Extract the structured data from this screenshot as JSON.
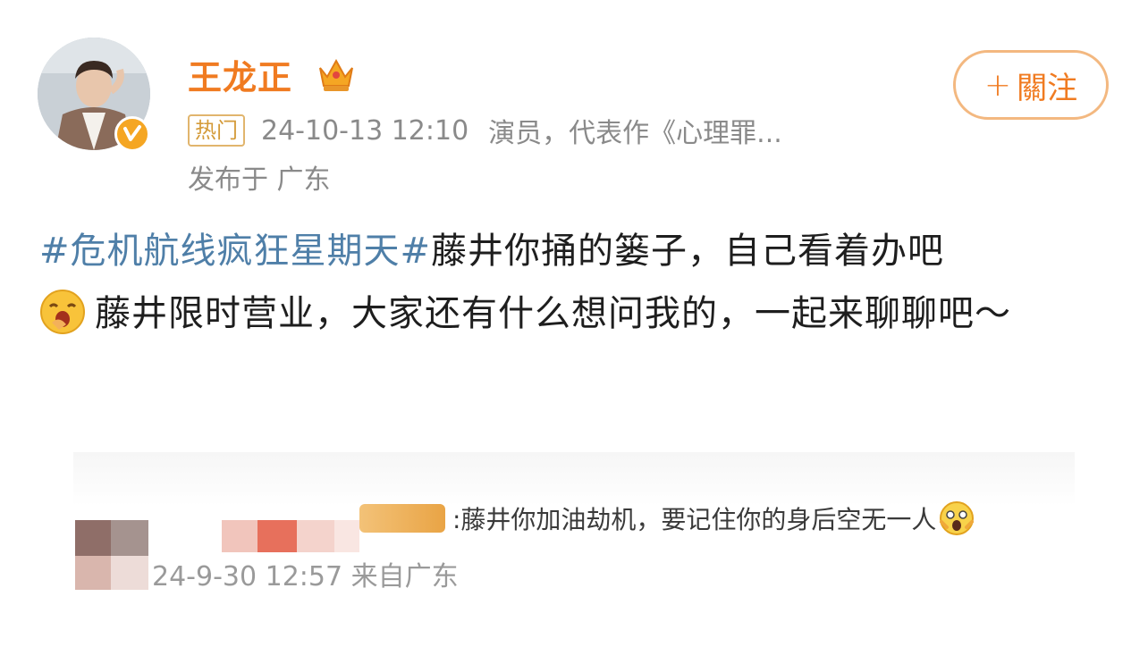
{
  "user": {
    "name": "王龙正",
    "badge": "热门",
    "time": "24-10-13 12:10",
    "description": "演员，代表作《心理罪...",
    "location": "发布于 广东"
  },
  "follow_button": {
    "plus": "+",
    "label": "關注"
  },
  "post": {
    "hashtag": "#危机航线疯狂星期天#",
    "line1_rest": "藤井你捅的篓子，自己看着办吧",
    "line2": "藤井限时营业，大家还有什么想问我的，一起来聊聊吧～"
  },
  "comment": {
    "text": ":藤井你加油劫机，要记住你的身后空无一人",
    "time": "24-9-30 12:57 来自广东"
  },
  "colors": {
    "name": "#f07b21",
    "hashtag": "#4f7fa8",
    "meta": "#8a8a8a",
    "follow_border": "#f3b880"
  },
  "icons": {
    "crown": "crown-icon",
    "verified": "verified-icon",
    "emoji_yawn": "yawn-emoji-icon",
    "emoji_scared": "scared-emoji-icon"
  }
}
